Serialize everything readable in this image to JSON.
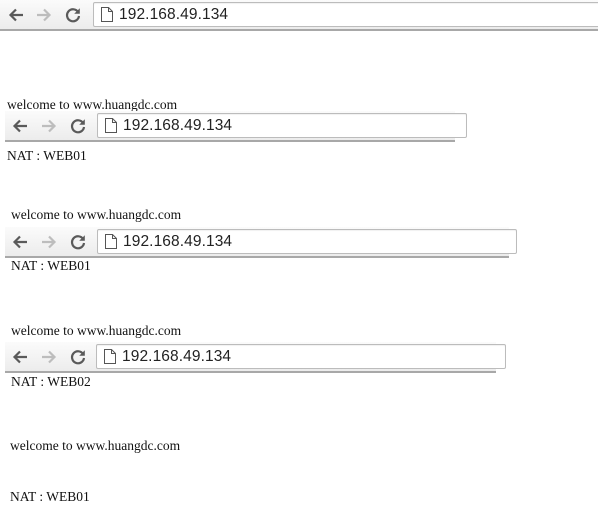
{
  "icons": {
    "back": "back-arrow-icon",
    "forward": "forward-arrow-icon",
    "reload": "reload-icon",
    "page": "page-icon"
  },
  "colors": {
    "toolbar_bottom_border": "#a8a8a8",
    "icon_enabled": "#5a5a5a",
    "icon_disabled": "#bdbdbd"
  },
  "windows": [
    {
      "url": "192.168.49.134",
      "lines": [
        "welcome to www.huangdc.com",
        "NAT : WEB01"
      ]
    },
    {
      "url": "192.168.49.134",
      "lines": [
        "welcome to www.huangdc.com",
        "NAT : WEB01"
      ]
    },
    {
      "url": "192.168.49.134",
      "lines": [
        "welcome to www.huangdc.com",
        "NAT : WEB02"
      ]
    },
    {
      "url": "192.168.49.134",
      "lines": [
        "welcome to www.huangdc.com",
        "NAT : WEB01"
      ]
    }
  ]
}
